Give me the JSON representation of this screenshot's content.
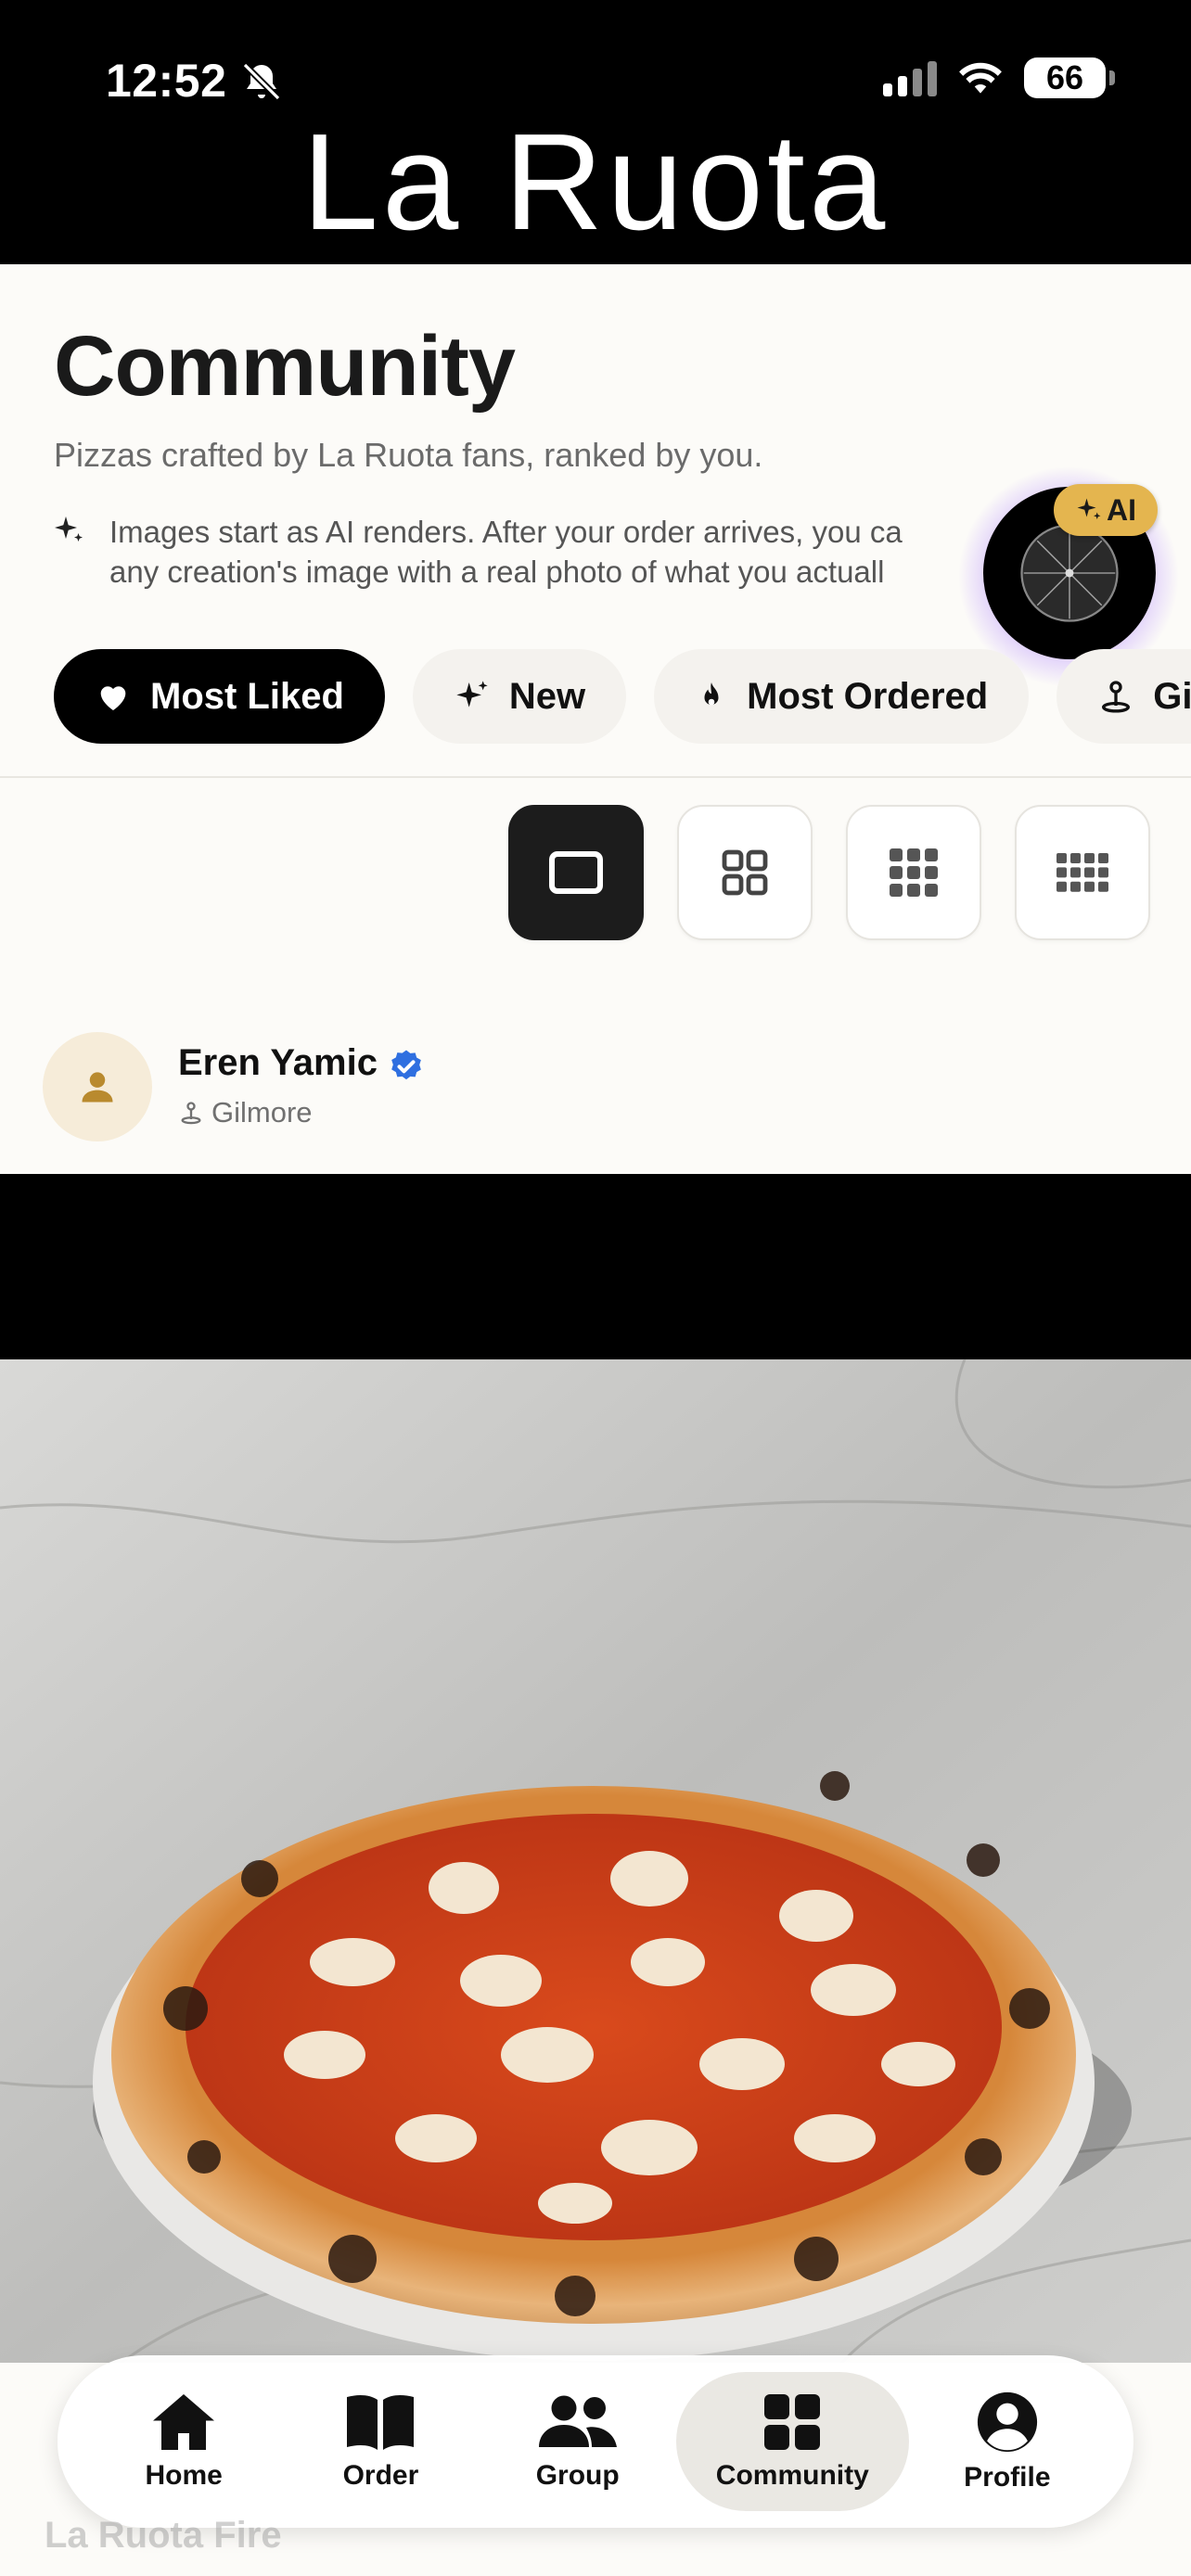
{
  "status_bar": {
    "time": "12:52",
    "battery": "66"
  },
  "brand": {
    "title": "La Ruota"
  },
  "community": {
    "title": "Community",
    "subtitle": "Pizzas crafted by La Ruota fans, ranked by you.",
    "note_line1": "Images start as AI renders. After your order arrives, you ca",
    "note_line2": "any creation's image with a real photo of what you actuall"
  },
  "ai_button": {
    "badge": "AI"
  },
  "filters": [
    {
      "label": "Most Liked",
      "icon": "heart-icon",
      "active": true
    },
    {
      "label": "New",
      "icon": "sparkle-icon",
      "active": false
    },
    {
      "label": "Most Ordered",
      "icon": "flame-icon",
      "active": false
    },
    {
      "label": "Gilr",
      "icon": "location-pin-icon",
      "active": false
    }
  ],
  "view_modes": [
    "single-column-view",
    "two-column-view",
    "three-column-view",
    "four-column-view"
  ],
  "post": {
    "author": "Eren Yamic",
    "location": "Gilmore"
  },
  "nav": {
    "items": [
      {
        "label": "Home",
        "icon": "home-icon"
      },
      {
        "label": "Order",
        "icon": "book-icon"
      },
      {
        "label": "Group",
        "icon": "group-icon"
      },
      {
        "label": "Community",
        "icon": "grid-icon"
      },
      {
        "label": "Profile",
        "icon": "profile-icon"
      }
    ]
  },
  "footer": {
    "ghost_text": "La Ruota Fire"
  },
  "colors": {
    "accent_gold": "#e4b54f",
    "verified_blue": "#2f6fe0",
    "ai_glow": "#a06eff"
  }
}
